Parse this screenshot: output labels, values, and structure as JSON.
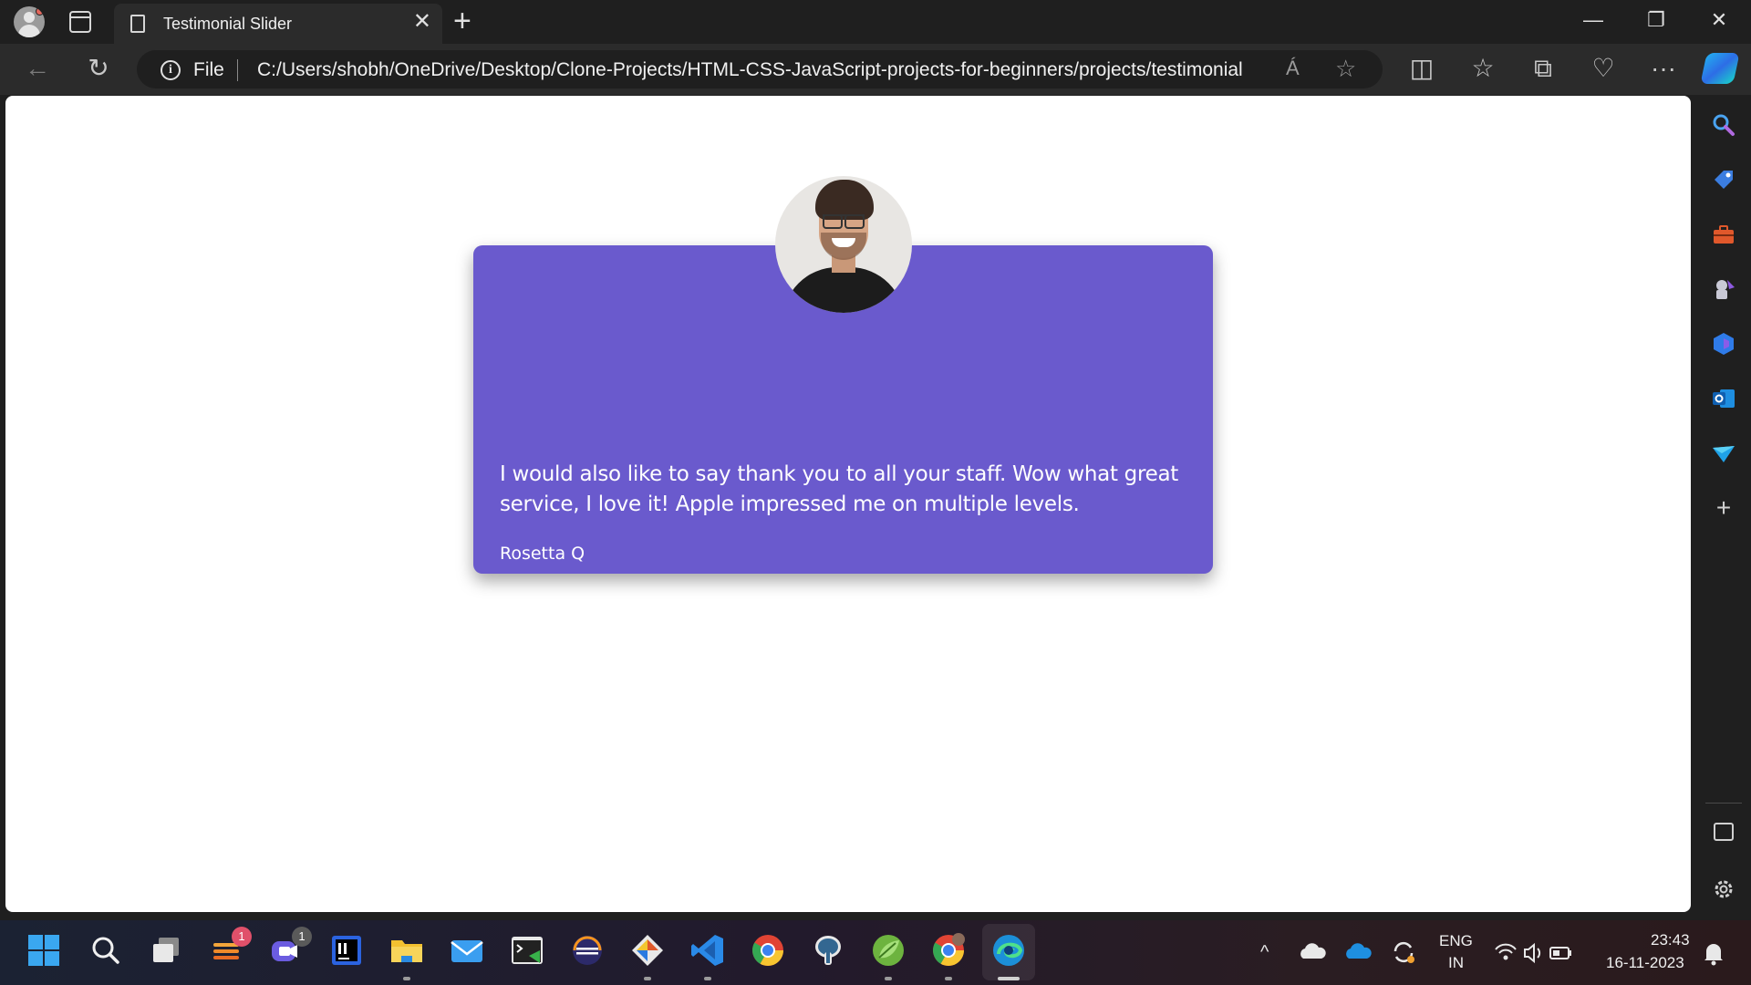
{
  "browser": {
    "tab_title": "Testimonial Slider",
    "tab_close": "✕",
    "new_tab": "+",
    "window_controls": {
      "minimize": "—",
      "restore": "❐",
      "close": "✕"
    },
    "address": {
      "scheme_label": "File",
      "url": "C:/Users/shobh/OneDrive/Desktop/Clone-Projects/HTML-CSS-JavaScript-projects-for-beginners/projects/testimonial-...",
      "read_aloud": "Á",
      "favorite": "☆"
    },
    "nav": {
      "back": "←",
      "refresh": "↻",
      "split": "◫",
      "favorites": "☆",
      "collections": "⧉",
      "health": "♡",
      "more": "···"
    }
  },
  "testimonial": {
    "quote": "I would also like to say thank you to all your staff. Wow what great service, I love it! Apple impressed me on multiple levels.",
    "author": "Rosetta Q"
  },
  "sidebar": {
    "add": "+",
    "icons": [
      "search-icon",
      "shopping-tag-icon",
      "tools-icon",
      "games-icon",
      "copilot-icon",
      "outlook-icon",
      "send-icon"
    ]
  },
  "taskbar": {
    "badges": {
      "widgets": "1",
      "teams": "1"
    },
    "tray": {
      "lang_top": "ENG",
      "lang_bottom": "IN",
      "time": "23:43",
      "date": "16-11-2023",
      "chevron": "^"
    }
  },
  "colors": {
    "card": "#6a5acd",
    "page": "#ffffff",
    "chrome": "#1f1f1f",
    "toolbar": "#2b2b2b"
  }
}
